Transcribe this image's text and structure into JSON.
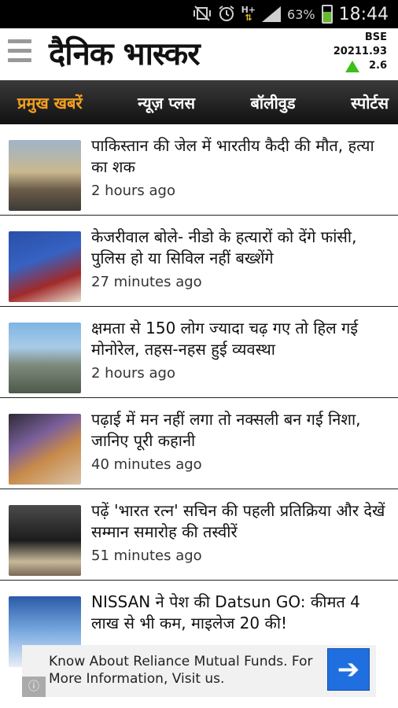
{
  "status_bar": {
    "icons": [
      "muted-vibrate-icon",
      "alarm-clock-icon",
      "h-plus-network-icon",
      "signal-icon",
      "battery-icon"
    ],
    "network": "H+",
    "battery_percent": "63%",
    "battery_level": 0.63,
    "time": "18:44"
  },
  "header": {
    "logo": "दैनिक भास्कर",
    "bse": {
      "label": "BSE",
      "value": "20211.93",
      "change": "2.6",
      "direction": "up"
    }
  },
  "tabs": [
    {
      "label": "प्रमुख खबरें",
      "active": true
    },
    {
      "label": "न्यूज़ प्लस",
      "active": false
    },
    {
      "label": "बॉलीवुड",
      "active": false
    },
    {
      "label": "स्पोर्टस",
      "active": false
    }
  ],
  "articles": [
    {
      "headline": "पाकिस्तान की जेल में भारतीय कैदी की मौत, हत्या का शक",
      "time": "2 hours ago"
    },
    {
      "headline": "केजरीवाल बोले- नीडो के हत्यारों को देंगे फांसी, पुलिस हो या सिविल नहीं बख्शेंगे",
      "time": "27 minutes ago"
    },
    {
      "headline": "क्षमता से 150 लोग ज्यादा चढ़ गए तो हिल गई मोनोरेल, तहस-नहस हुई व्यवस्था",
      "time": "2 hours ago"
    },
    {
      "headline": "पढ़ाई में मन नहीं लगा तो नक्सली बन गई निशा, जानिए पूरी कहानी",
      "time": "40 minutes ago"
    },
    {
      "headline": "पढ़ें 'भारत रत्न' सचिन की पहली प्रतिक्रिया और देखें सम्मान समारोह की तस्वीरें",
      "time": "51 minutes ago"
    },
    {
      "headline": "NISSAN ने पेश की Datsun GO: कीमत 4 लाख से भी कम, माइलेज 20 की!",
      "time": ""
    }
  ],
  "ad": {
    "text": "Know About Reliance Mutual Funds. For More Information, Visit us.",
    "button_icon": "arrow-right-icon",
    "info_icon": "info-icon",
    "button_color": "#1f6fe0"
  },
  "colors": {
    "active_tab": "#f5a020",
    "bse_up": "#3cbf1a"
  }
}
